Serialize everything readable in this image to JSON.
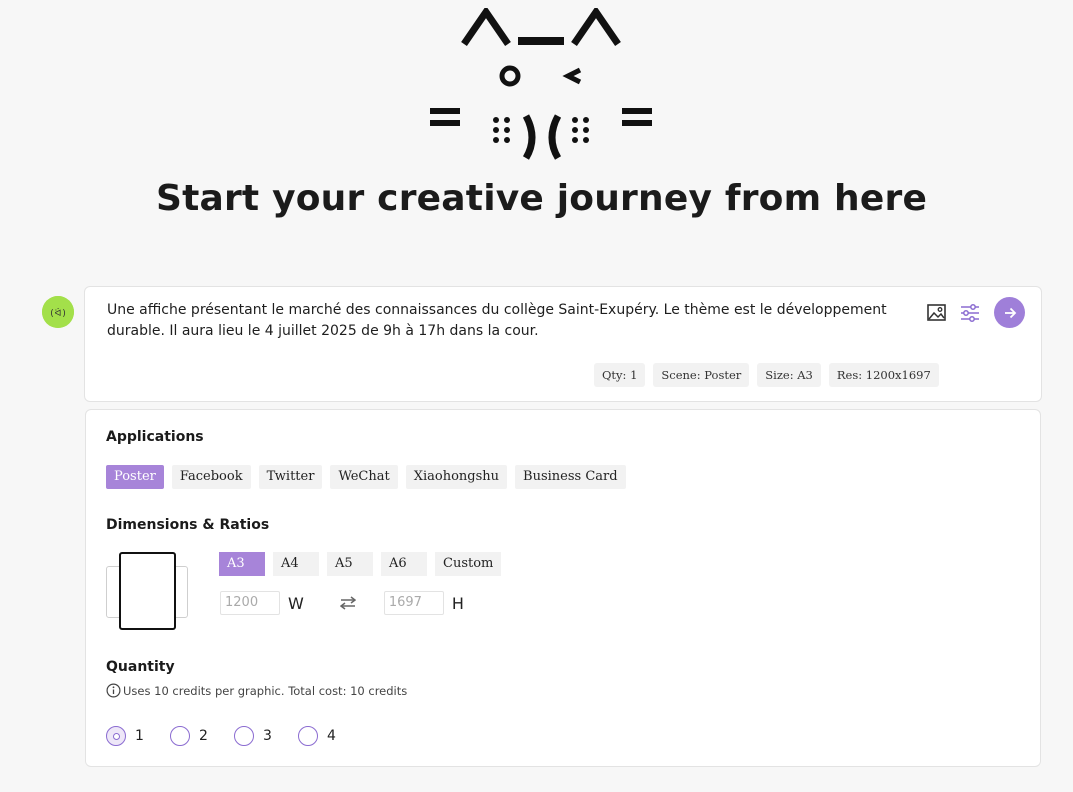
{
  "hero": {
    "title": "Start your creative journey from here"
  },
  "prompt": {
    "text": "Une affiche présentant le marché des connaissances du collège Saint-Exupéry. Le thème est le développement durable. Il aura lieu le 4 juillet 2025 de 9h à 17h dans la cour.",
    "tags": [
      "Qty: 1",
      "Scene: Poster",
      "Size: A3",
      "Res: 1200x1697"
    ]
  },
  "applications": {
    "title": "Applications",
    "items": [
      "Poster",
      "Facebook",
      "Twitter",
      "WeChat",
      "Xiaohongshu",
      "Business Card"
    ],
    "selected": "Poster"
  },
  "dimensions": {
    "title": "Dimensions & Ratios",
    "sizes": [
      "A3",
      "A4",
      "A5",
      "A6",
      "Custom"
    ],
    "selected": "A3",
    "width_placeholder": "1200",
    "height_placeholder": "1697",
    "width_label": "W",
    "height_label": "H"
  },
  "quantity": {
    "title": "Quantity",
    "info": "Uses 10 credits per graphic. Total cost: 10 credits",
    "options": [
      "1",
      "2",
      "3",
      "4"
    ],
    "selected": "1"
  },
  "colors": {
    "accent": "#a784d9",
    "send": "#9f7fd9",
    "avatar": "#a3e04a"
  },
  "icons": {
    "image": "image-icon",
    "settings": "sliders-icon",
    "send": "arrow-right-icon",
    "info": "info-icon",
    "swap": "swap-icon"
  }
}
